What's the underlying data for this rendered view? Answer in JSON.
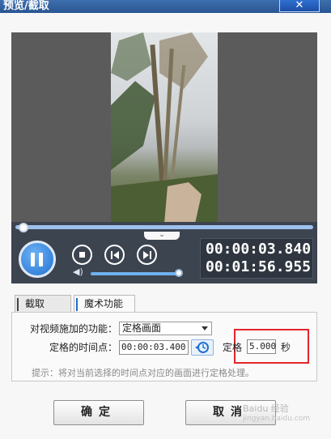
{
  "window": {
    "title": "预览/截取",
    "close_label": "✕"
  },
  "player": {
    "collapse_glyph": "⌄",
    "current_time": "00:00:03.840",
    "total_time": "00:01:56.955",
    "seek_progress": 0.03,
    "volume_level": 0.95,
    "icons": [
      "pause-icon",
      "stop-icon",
      "prev-frame-icon",
      "next-frame-icon",
      "volume-icon"
    ]
  },
  "tabs": [
    {
      "label": "截取",
      "active": false
    },
    {
      "label": "魔术功能",
      "active": true
    }
  ],
  "magic": {
    "effect_label": "对视频施加的功能：",
    "effect_value": "定格画面",
    "timepoint_label": "定格的时间点：",
    "timepoint_value": "00:00:03.400",
    "freeze_label": "定格",
    "freeze_value": "5.000",
    "freeze_unit": "秒",
    "hint": "提示：将对当前选择的时间点对应的画面进行定格处理。"
  },
  "buttons": {
    "ok": "确定",
    "cancel": "取消"
  },
  "watermark": {
    "text": "Baidu 经验",
    "url": "jingyan.baidu.com"
  },
  "colors": {
    "titlebar": "#2f5e9f",
    "accent": "#1e6fd0",
    "highlight_box": "#e3262b",
    "controls_bg": "#3c4450"
  }
}
